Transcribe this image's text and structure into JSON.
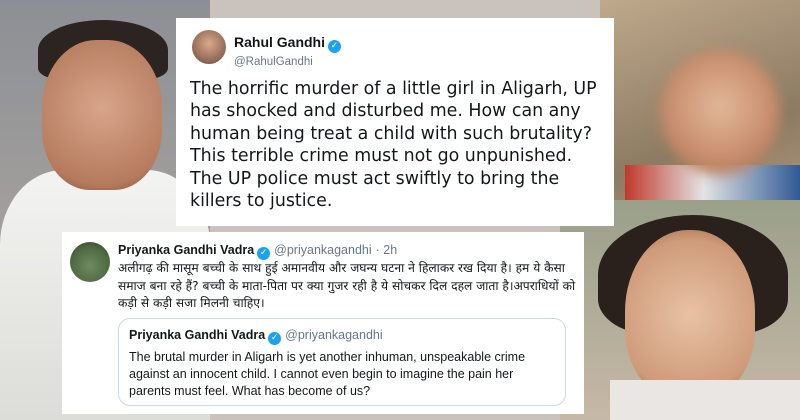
{
  "tweet1": {
    "name": "Rahul Gandhi",
    "handle": "@RahulGandhi",
    "verified_symbol": "✓",
    "text": "The horrific murder of a little girl in Aligarh, UP has shocked and disturbed me. How can any human being treat a child with such brutality? This terrible crime must not go unpunished. The UP police must act swiftly to bring the killers to justice."
  },
  "tweet2": {
    "name": "Priyanka Gandhi Vadra",
    "handle": "@priyankagandhi",
    "time": "· 2h",
    "verified_symbol": "✓",
    "text": "अलीगढ़ की मासूम बच्ची के साथ हुई अमानवीय और जघन्य घटना ने हिलाकर रख दिया है। हम ये कैसा समाज बना रहे हैं? बच्ची के माता-पिता पर क्या गुजर रही है ये सोचकर दिल दहल जाता है।अपराधियों को कड़ी से कड़ी सजा मिलनी चाहिए।",
    "quote": {
      "name": "Priyanka Gandhi Vadra",
      "handle": "@priyankagandhi",
      "verified_symbol": "✓",
      "text": "The brutal murder in Aligarh is yet another inhuman, unspeakable crime against an innocent child. I cannot even begin to imagine the pain her parents must feel. What has become of us?"
    }
  },
  "colors": {
    "verified": "#1da1f2",
    "handle": "#657786",
    "text": "#14171a"
  }
}
